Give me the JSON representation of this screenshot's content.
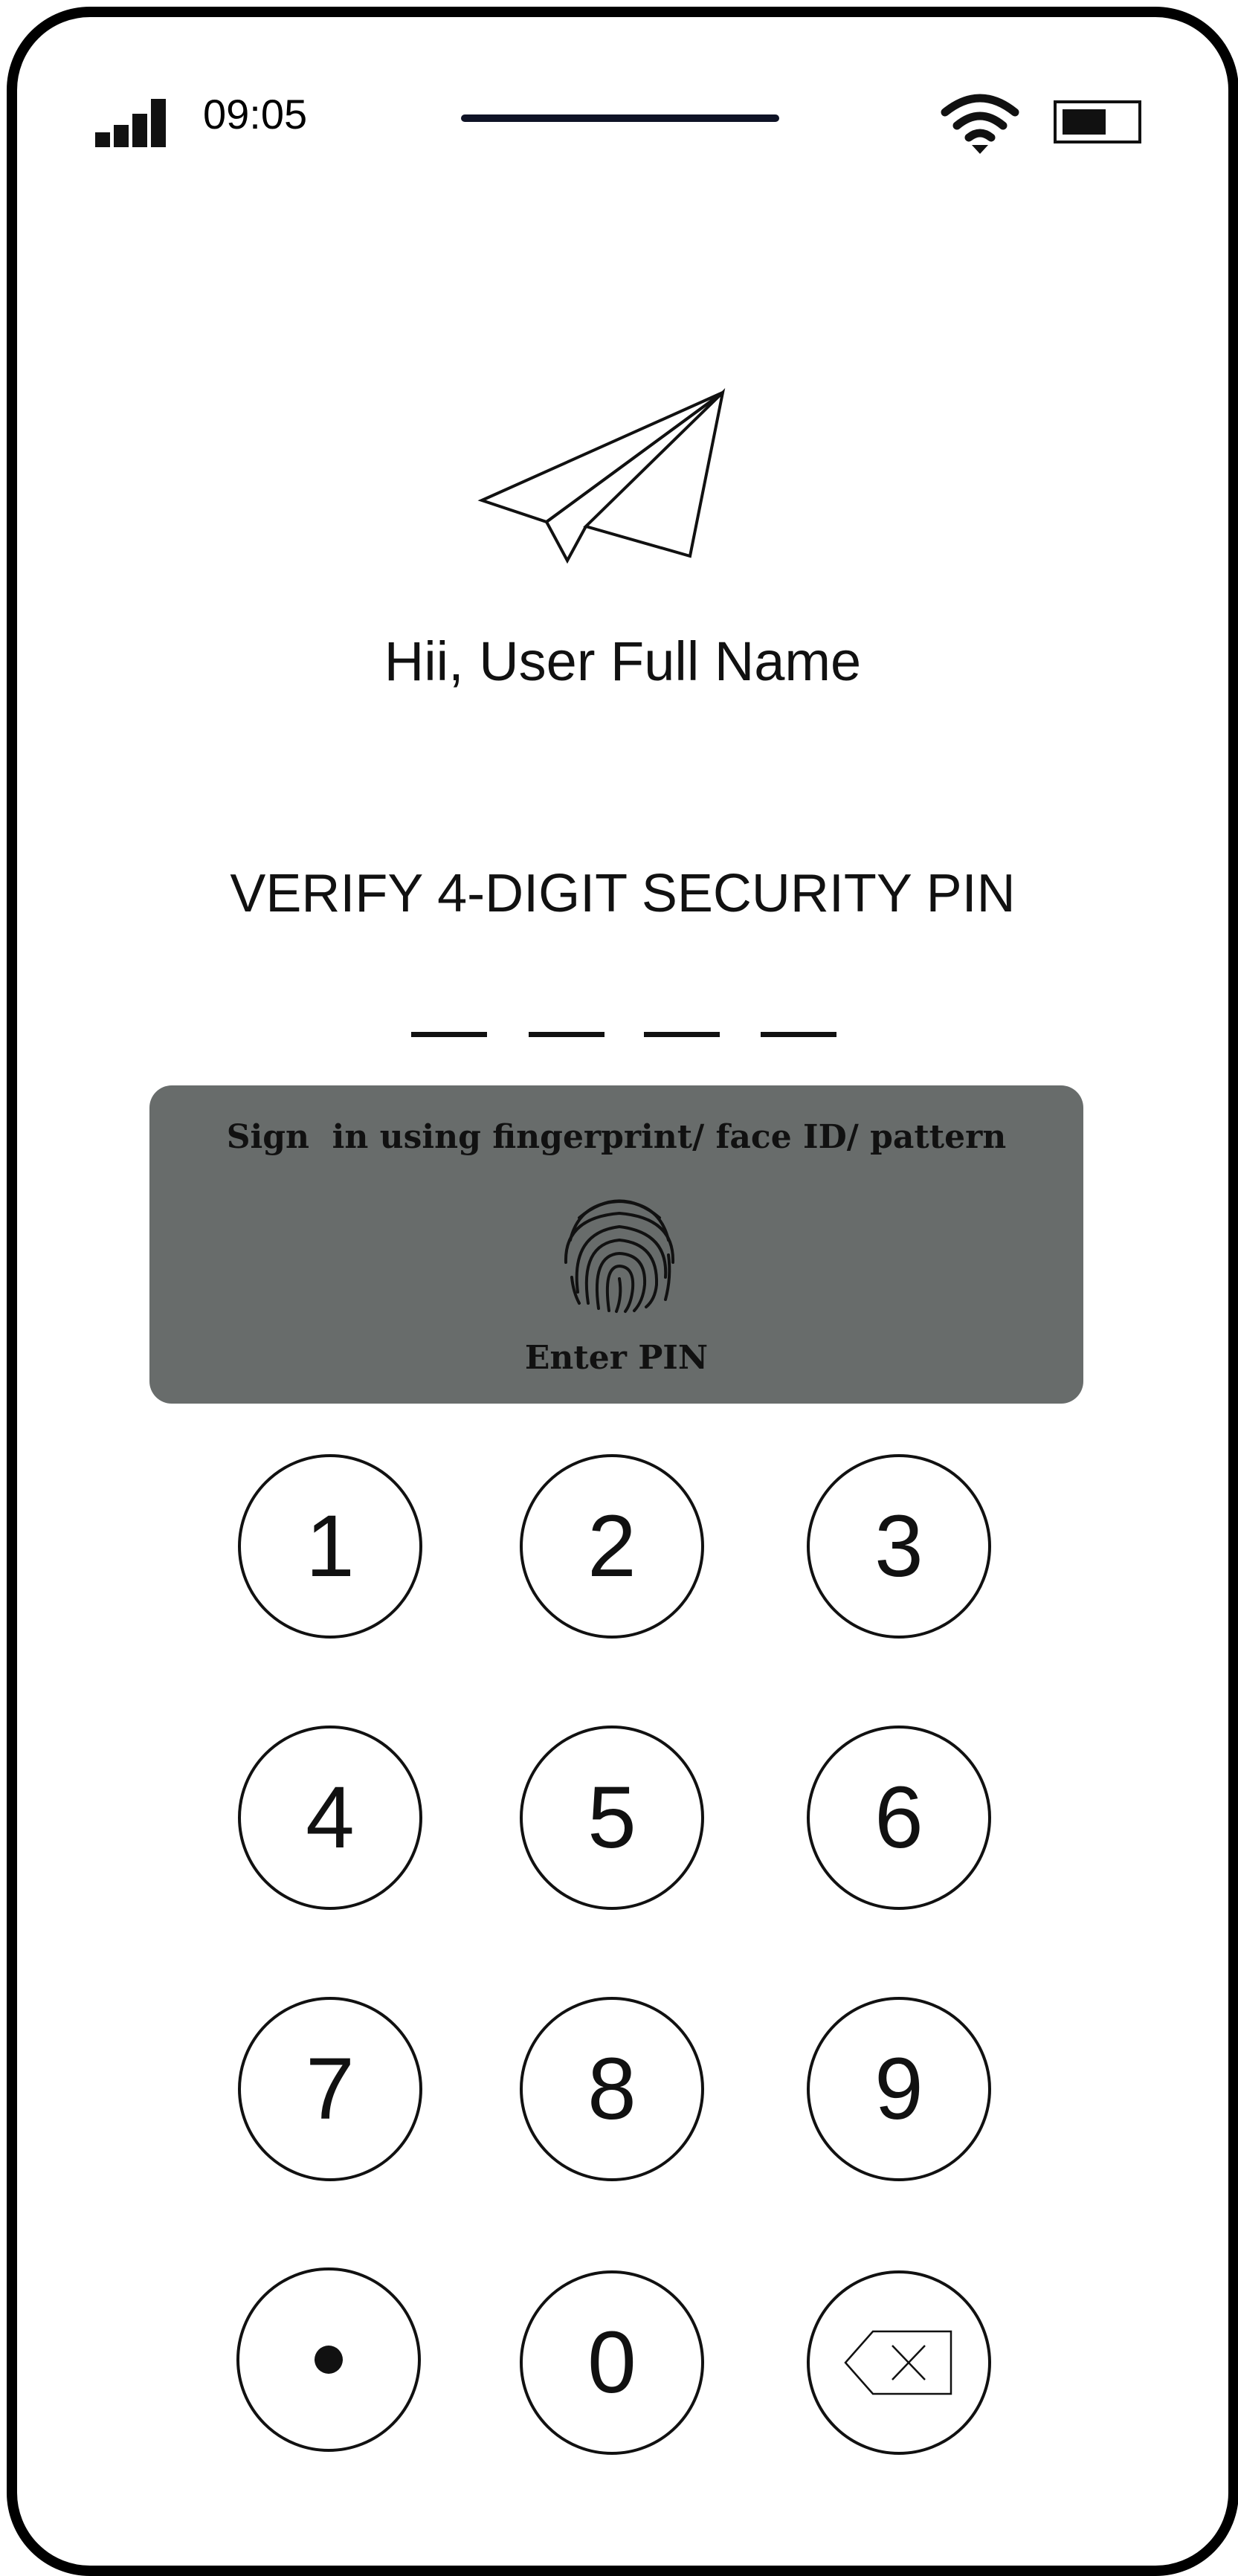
{
  "status_bar": {
    "time": "09:05",
    "signal_icon": "signal-bars-icon",
    "wifi_icon": "wifi-icon",
    "battery_icon": "battery-icon"
  },
  "header": {
    "logo_icon": "paper-plane-icon",
    "greeting": "Hii, User Full Name"
  },
  "pin": {
    "title": "VERIFY 4-DIGIT SECURITY PIN",
    "digits_total": 4,
    "digits_entered": 0
  },
  "biometric": {
    "prompt": "Sign  in using fingerprint/ face ID/ pattern",
    "icon": "fingerprint-icon",
    "fallback_label": "Enter PIN",
    "panel_color": "#686c6b"
  },
  "keypad": {
    "keys": [
      "1",
      "2",
      "3",
      "4",
      "5",
      "6",
      "7",
      "8",
      "9",
      "•",
      "0",
      "⌫"
    ],
    "dot_icon": "dot-icon",
    "backspace_icon": "backspace-icon"
  }
}
